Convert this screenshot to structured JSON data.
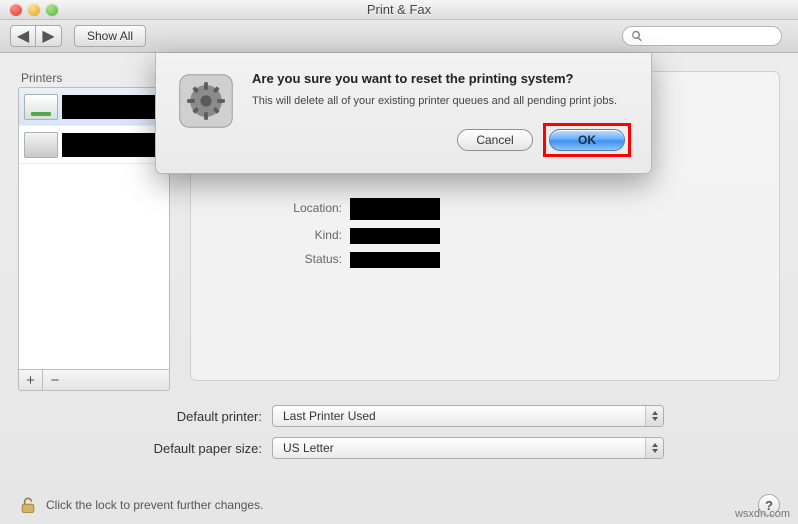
{
  "window": {
    "title": "Print & Fax"
  },
  "toolbar": {
    "back_label": "◀",
    "fwd_label": "▶",
    "show_all": "Show All",
    "search_placeholder": ""
  },
  "sidebar": {
    "header": "Printers",
    "add_label": "+",
    "remove_label": "−"
  },
  "detail": {
    "location_label": "Location:",
    "kind_label": "Kind:",
    "status_label": "Status:"
  },
  "defaults": {
    "printer_label": "Default printer:",
    "printer_value": "Last Printer Used",
    "paper_label": "Default paper size:",
    "paper_value": "US Letter"
  },
  "lock": {
    "text": "Click the lock to prevent further changes."
  },
  "help": {
    "label": "?"
  },
  "dialog": {
    "title": "Are you sure you want to reset the printing system?",
    "message": "This will delete all of your existing printer queues and all pending print jobs.",
    "cancel": "Cancel",
    "ok": "OK"
  },
  "watermark": "wsxdn.com"
}
